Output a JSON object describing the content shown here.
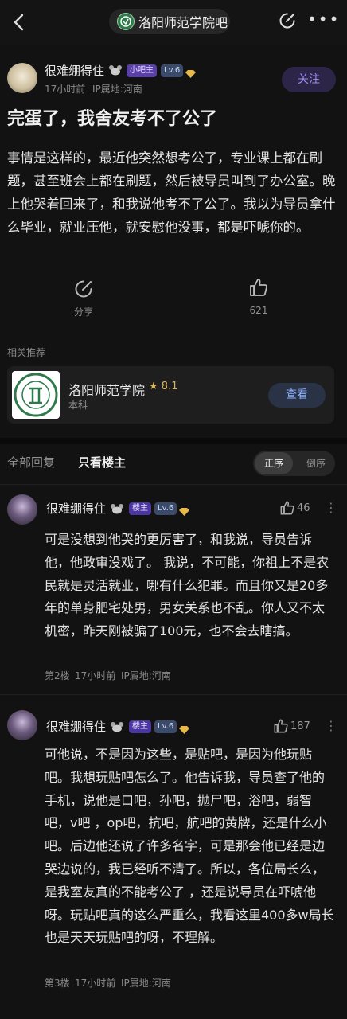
{
  "header": {
    "back_icon": "chevron-left-icon",
    "forum_name": "洛阳师范学院吧",
    "edit_icon": "edit-icon",
    "more_icon": "more-icon"
  },
  "post": {
    "author": "很难绷得住",
    "badge_small_host": "小吧主",
    "level": "Lv.6",
    "time": "17小时前",
    "ip": "IP属地:河南",
    "follow_label": "关注",
    "title": "完蛋了，我舍友考不了公了",
    "body": "事情是这样的，最近他突然想考公了，专业课上都在刷题，甚至班会上都在刷题，然后被导员叫到了办公室。晚上他哭着回来了，和我说他考不了公了。我以为导员拿什么毕业，就业压他，就安慰他没事，都是吓唬你的。",
    "share_label": "分享",
    "like_count": "621"
  },
  "related": {
    "title": "相关推荐",
    "name": "洛阳师范学院",
    "rating": "8.1",
    "type": "本科",
    "view_label": "查看"
  },
  "tabs": {
    "all": "全部回复",
    "op_only": "只看楼主",
    "sort_asc": "正序",
    "sort_desc": "倒序"
  },
  "replies": [
    {
      "author": "很难绷得住",
      "badge": "楼主",
      "level": "Lv.6",
      "likes": "46",
      "text": "可是没想到他哭的更厉害了，和我说，导员告诉他，他政审没戏了。 我说，不可能，你祖上不是农民就是灵活就业，哪有什么犯罪。而且你又是20多年的单身肥宅处男，男女关系也不乱。你人又不太机密，昨天刚被骗了100元，也不会去瞎搞。",
      "floor": "第2楼",
      "time": "17小时前",
      "ip": "IP属地:河南"
    },
    {
      "author": "很难绷得住",
      "badge": "楼主",
      "level": "Lv.6",
      "likes": "187",
      "text": "可他说，不是因为这些，是贴吧，是因为他玩贴吧。我想玩贴吧怎么了。他告诉我，导员查了他的手机，说他是口吧，孙吧，抛尸吧，浴吧，弱智吧，v吧 ，op吧，抗吧，航吧的黄牌，还是什么小吧。后边他还说了许多名字，可是那会他已经是边哭边说的，我已经听不清了。所以，各位局长么，是我室友真的不能考公了 ，还是说导员在吓唬他呀。玩贴吧真的这么严重么，我看这里400多w局长也是天天玩贴吧的呀，不理解。",
      "floor": "第3楼",
      "time": "17小时前",
      "ip": "IP属地:河南"
    }
  ],
  "colors": {
    "background": "#121212",
    "accent_purple": "#9d8df1",
    "accent_blue": "#8ab0ff",
    "rating_gold": "#d8b45a"
  }
}
